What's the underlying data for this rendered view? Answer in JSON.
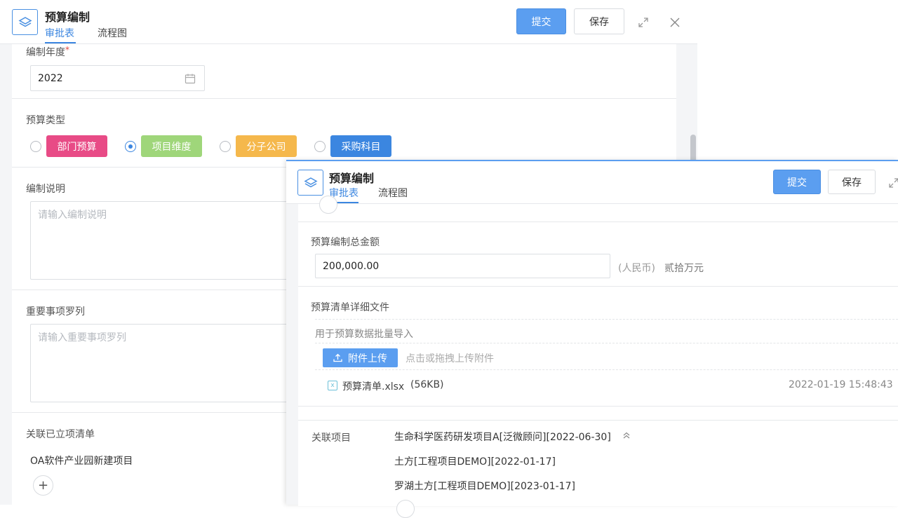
{
  "back_window": {
    "title": "预算编制",
    "tabs": [
      {
        "label": "审批表"
      },
      {
        "label": "流程图"
      }
    ],
    "submit_label": "提交",
    "save_label": "保存",
    "fields": {
      "year": {
        "label": "编制年度",
        "required_mark": "*",
        "value": "2022"
      },
      "budget_type": {
        "label": "预算类型",
        "options": [
          {
            "label": "部门预算",
            "color": "#e84b86"
          },
          {
            "label": "项目维度",
            "color": "#9fd67a"
          },
          {
            "label": "分子公司",
            "color": "#f5b84c"
          },
          {
            "label": "采购科目",
            "color": "#3b86e0"
          }
        ],
        "selected": "项目维度"
      },
      "description": {
        "label": "编制说明",
        "placeholder": "请输入编制说明"
      },
      "key_items": {
        "label": "重要事项罗列",
        "placeholder": "请输入重要事项罗列"
      },
      "related_projects": {
        "label": "关联已立项清单",
        "items": [
          "OA软件产业园新建项目"
        ]
      }
    }
  },
  "front_window": {
    "title": "预算编制",
    "tabs": [
      {
        "label": "审批表"
      },
      {
        "label": "流程图"
      }
    ],
    "submit_label": "提交",
    "save_label": "保存",
    "total_amount": {
      "label": "预算编制总金额",
      "value": "200,000.00",
      "currency": "(人民币)",
      "amount_in_words": "贰拾万元"
    },
    "detail_file": {
      "label": "预算清单详细文件",
      "hint": "用于预算数据批量导入",
      "upload_label": "附件上传",
      "upload_hint": "点击或拖拽上传附件",
      "file": {
        "name": "预算清单.xlsx",
        "size": "(56KB)",
        "time": "2022-01-19 15:48:43"
      }
    },
    "related": {
      "label": "关联项目",
      "items": [
        "生命科学医药研发项目A[泛微顾问][2022-06-30]",
        "土方[工程项目DEMO][2022-01-17]",
        "罗湖土方[工程项目DEMO][2023-01-17]"
      ]
    }
  }
}
